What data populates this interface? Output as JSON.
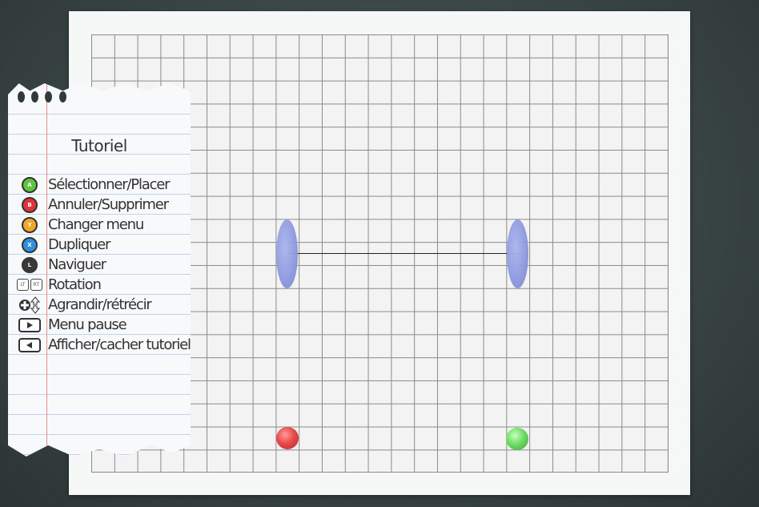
{
  "colors": {
    "background": "#3e4a4a",
    "paper": "#f6f7f7",
    "grid_line": "#8a8a8a",
    "paddle": "#8b97de",
    "ball_red": "#e94a4a",
    "ball_green": "#6fdc64",
    "button_a": "#5fc43f",
    "button_b": "#e0343a",
    "button_y": "#f1a52b",
    "button_x": "#2f8fe0",
    "button_l": "#3a3a3a"
  },
  "tutorial": {
    "title": "Tutoriel",
    "items": [
      {
        "icon": "a-button-icon",
        "glyph": "A",
        "label": "Sélectionner/Placer"
      },
      {
        "icon": "b-button-icon",
        "glyph": "B",
        "label": "Annuler/Supprimer"
      },
      {
        "icon": "y-button-icon",
        "glyph": "Y",
        "label": "Changer menu"
      },
      {
        "icon": "x-button-icon",
        "glyph": "X",
        "label": "Dupliquer"
      },
      {
        "icon": "left-stick-icon",
        "glyph": "L",
        "label": "Naviguer"
      },
      {
        "icon": "trigger-buttons-icon",
        "glyph": "LT RT",
        "label": "Rotation"
      },
      {
        "icon": "dpad-updown-icon",
        "glyph": "",
        "label": "Agrandir/rétrécir"
      },
      {
        "icon": "start-button-icon",
        "glyph": "",
        "label": "Menu pause"
      },
      {
        "icon": "back-button-icon",
        "glyph": "",
        "label": "Afficher/cacher tutoriel"
      }
    ]
  }
}
